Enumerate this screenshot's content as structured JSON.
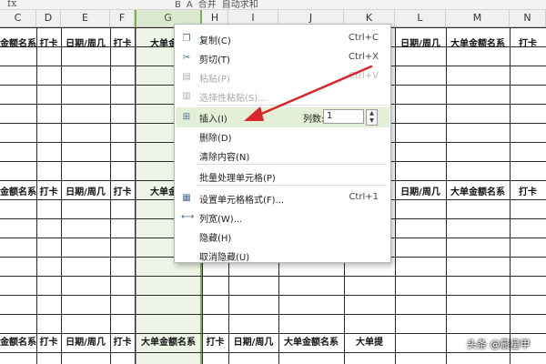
{
  "formula_bar": {
    "fx_label": "fx"
  },
  "toolbar": {
    "fragment_items": [
      "B",
      "A",
      "合并",
      "自动求和"
    ]
  },
  "column_headers": {
    "columns": [
      "C",
      "D",
      "E",
      "F",
      "G",
      "H",
      "I",
      "J",
      "K",
      "L",
      "M",
      "N"
    ],
    "selected": "G"
  },
  "table": {
    "header_rows": [
      [
        "金额名系",
        "打卡",
        "日期/周几",
        "打卡",
        "大单金额",
        "",
        "",
        "",
        "",
        "日期/周几",
        "大单金额名系",
        "打卡"
      ],
      [
        "金额名系",
        "打卡",
        "日期/周几",
        "打卡",
        "大单金额",
        "",
        "",
        "",
        "",
        "日期/周几",
        "大单金额名系",
        "打卡"
      ],
      [
        "金额名系",
        "打卡",
        "日期/周几",
        "打卡",
        "大单金额名系",
        "打卡",
        "日期/周几",
        "大单金额名系",
        "大单提",
        "",
        "",
        ""
      ]
    ]
  },
  "context_menu": {
    "items": [
      {
        "icon": "copy-icon",
        "label": "复制(C)",
        "shortcut": "Ctrl+C",
        "disabled": false
      },
      {
        "icon": "cut-icon",
        "label": "剪切(T)",
        "shortcut": "Ctrl+X",
        "disabled": false
      },
      {
        "icon": "paste-icon",
        "label": "粘贴(P)",
        "shortcut": "Ctrl+V",
        "disabled": true
      },
      {
        "icon": "paste-special-icon",
        "label": "选择性粘贴(S)...",
        "shortcut": "",
        "disabled": true
      },
      {
        "icon": "insert-icon",
        "label": "插入(I)",
        "shortcut": "",
        "disabled": false
      },
      {
        "icon": "",
        "label": "删除(D)",
        "shortcut": "",
        "disabled": false
      },
      {
        "icon": "",
        "label": "清除内容(N)",
        "shortcut": "",
        "disabled": false
      },
      {
        "icon": "",
        "label": "批量处理单元格(P)",
        "shortcut": "",
        "disabled": false
      },
      {
        "icon": "format-cells-icon",
        "label": "设置单元格格式(F)...",
        "shortcut": "Ctrl+1",
        "disabled": false
      },
      {
        "icon": "column-width-icon",
        "label": "列宽(W)...",
        "shortcut": "",
        "disabled": false
      },
      {
        "icon": "",
        "label": "隐藏(H)",
        "shortcut": "",
        "disabled": false
      },
      {
        "icon": "",
        "label": "取消隐藏(U)",
        "shortcut": "",
        "disabled": false
      }
    ],
    "insert_columns_label": "列数:",
    "insert_columns_value": "1"
  },
  "annotation": {
    "arrow_color": "#d9262a"
  },
  "colors": {
    "selection": "#7cb05a",
    "menu_highlight": "#e3efd6"
  },
  "watermark": {
    "text": "头条 @晨星甲"
  }
}
